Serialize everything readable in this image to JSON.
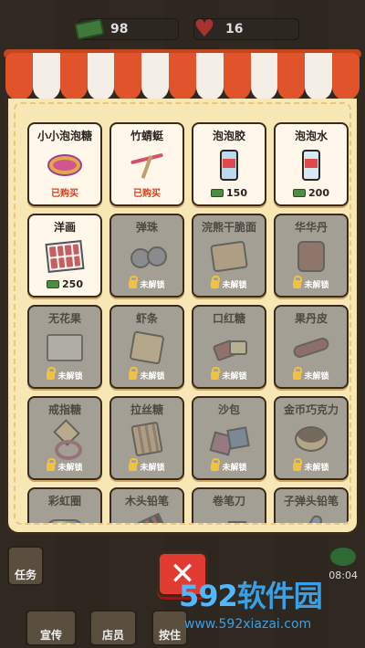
{
  "header": {
    "money": "98",
    "hearts": "16"
  },
  "shop": {
    "items": [
      {
        "name": "小小泡泡糖",
        "status": "已购买",
        "icon": "candy-tin-icon"
      },
      {
        "name": "竹蜻蜓",
        "status": "已购买",
        "icon": "bamboo-dragonfly-icon"
      },
      {
        "name": "泡泡胶",
        "price": "150",
        "icon": "bubble-glue-icon"
      },
      {
        "name": "泡泡水",
        "price": "200",
        "icon": "bubble-water-icon"
      },
      {
        "name": "洋画",
        "price": "250",
        "icon": "picture-cards-icon"
      },
      {
        "name": "弹珠",
        "status": "未解锁",
        "icon": "marbles-icon"
      },
      {
        "name": "浣熊干脆面",
        "status": "未解锁",
        "icon": "noodle-snack-icon"
      },
      {
        "name": "华华丹",
        "status": "未解锁",
        "icon": "candy-jar-icon"
      },
      {
        "name": "无花果",
        "status": "未解锁",
        "icon": "fig-packs-icon"
      },
      {
        "name": "虾条",
        "status": "未解锁",
        "icon": "shrimp-chips-icon"
      },
      {
        "name": "口红糖",
        "status": "未解锁",
        "icon": "lipstick-candy-icon"
      },
      {
        "name": "果丹皮",
        "status": "未解锁",
        "icon": "fruit-roll-icon"
      },
      {
        "name": "戒指糖",
        "status": "未解锁",
        "icon": "ring-candy-icon"
      },
      {
        "name": "拉丝糖",
        "status": "未解锁",
        "icon": "pull-candy-icon"
      },
      {
        "name": "沙包",
        "status": "未解锁",
        "icon": "sandbag-icon"
      },
      {
        "name": "金币巧克力",
        "status": "未解锁",
        "icon": "coin-chocolate-icon"
      },
      {
        "name": "彩虹圈",
        "icon": "rainbow-spring-icon"
      },
      {
        "name": "木头铅笔",
        "icon": "wood-pencils-icon"
      },
      {
        "name": "卷笔刀",
        "icon": "sharpener-icon"
      },
      {
        "name": "子弹头铅笔",
        "icon": "bullet-pencil-icon"
      }
    ]
  },
  "hud": {
    "task": "任务",
    "promo": "宣传",
    "shop": "店员",
    "third": "按住",
    "time": "08:04"
  },
  "watermark": {
    "logo_num": "592",
    "logo_text": "软件园",
    "url": "www.592xiazai.com"
  },
  "colors": {
    "awning_red": "#e1542b",
    "panel_bg": "#f7e7b5",
    "locked_bg": "#a39f94",
    "close_red": "#e13b32",
    "bought_text": "#d2421f"
  }
}
